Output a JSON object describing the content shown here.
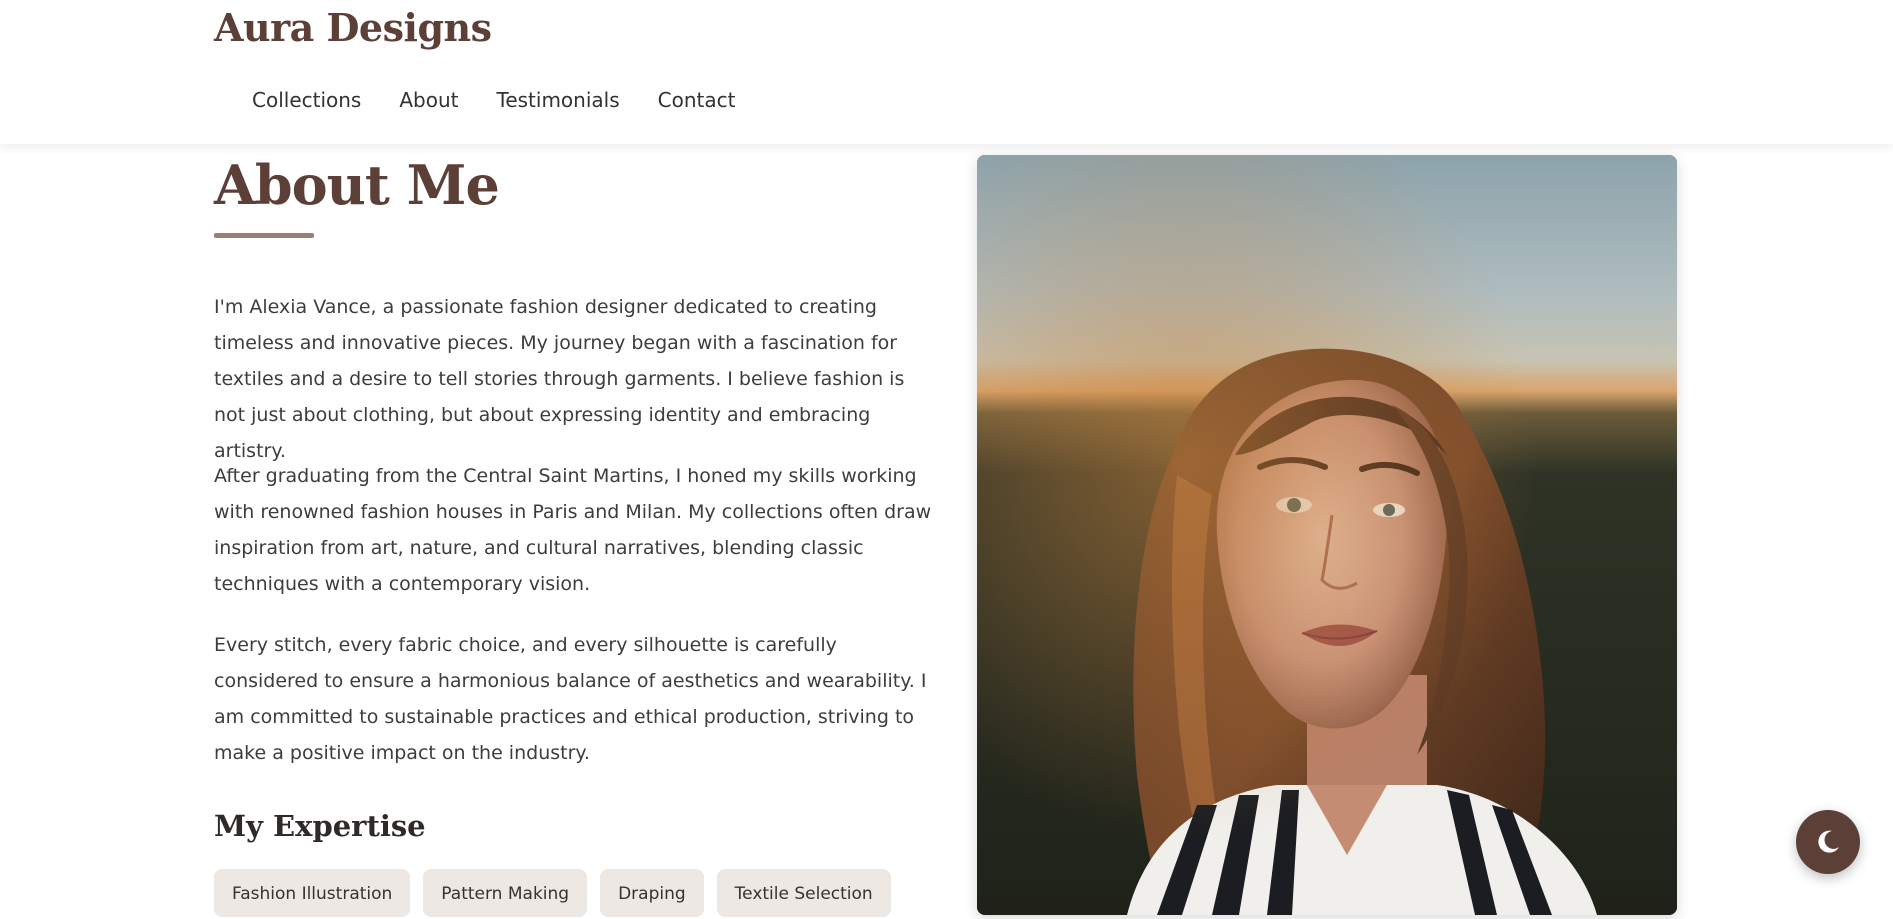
{
  "header": {
    "brand": "Aura Designs",
    "nav": [
      {
        "label": "Collections"
      },
      {
        "label": "About"
      },
      {
        "label": "Testimonials"
      },
      {
        "label": "Contact"
      }
    ]
  },
  "about": {
    "title": "About Me",
    "paragraphs": [
      "I'm Alexia Vance, a passionate fashion designer dedicated to creating timeless and innovative pieces. My journey began with a fascination for textiles and a desire to tell stories through garments. I believe fashion is not just about clothing, but about expressing identity and embracing artistry.",
      "After graduating from the Central Saint Martins, I honed my skills working with renowned fashion houses in Paris and Milan. My collections often draw inspiration from art, nature, and cultural narratives, blending classic techniques with a contemporary vision.",
      "Every stitch, every fabric choice, and every silhouette is carefully considered to ensure a harmonious balance of aesthetics and wearability. I am committed to sustainable practices and ethical production, striving to make a positive impact on the industry."
    ],
    "expertise_title": "My Expertise",
    "expertise": [
      "Fashion Illustration",
      "Pattern Making",
      "Draping",
      "Textile Selection"
    ]
  },
  "photo": {
    "subject": "portrait photo of a woman with long brown hair in a striped shirt, outdoor sunset background"
  },
  "theme_toggle": {
    "icon": "moon-icon"
  },
  "colors": {
    "brand": "#5c3f36",
    "accent_underline": "#9b7f76",
    "tag_bg": "#eee8e4",
    "text": "#3d3d3d"
  }
}
